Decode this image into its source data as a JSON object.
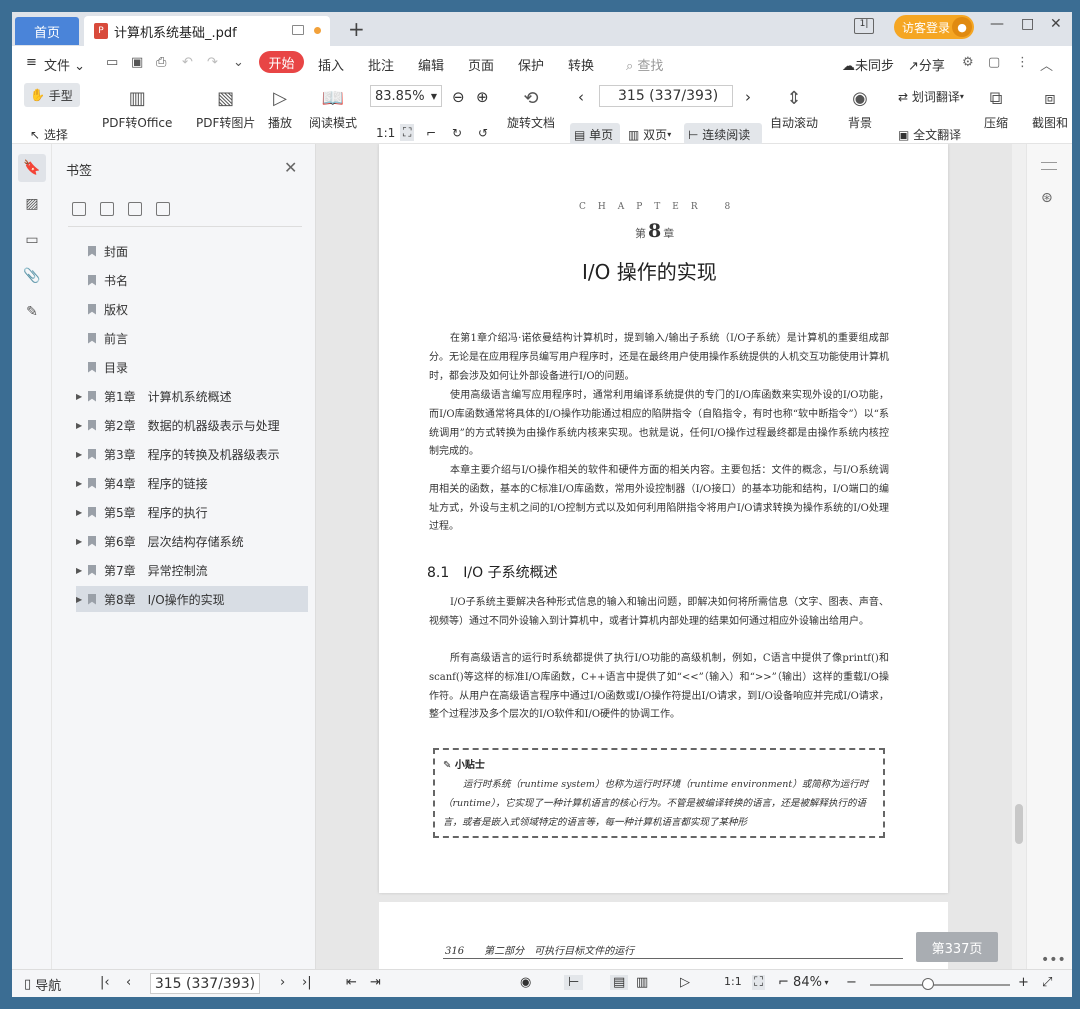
{
  "titlebar": {
    "home_tab": "首页",
    "doc_tab": "计算机系统基础_.pdf",
    "login": "访客登录",
    "pdf_icon": "P"
  },
  "menu": {
    "file": "文件",
    "items": [
      "开始",
      "插入",
      "批注",
      "编辑",
      "页面",
      "保护",
      "转换"
    ],
    "search": "查找",
    "unsync": "未同步",
    "share": "分享"
  },
  "ribbon": {
    "hand": "手型",
    "select": "选择",
    "pdf_office": "PDF转Office",
    "pdf_image": "PDF转图片",
    "play": "播放",
    "read_mode": "阅读模式",
    "zoom": "83.85%",
    "page": "315 (337/393)",
    "rotate": "旋转文档",
    "single": "单页",
    "double": "双页",
    "continuous": "连续阅读",
    "auto_scroll": "自动滚动",
    "background": "背景",
    "word_translate": "划词翻译",
    "full_translate": "全文翻译",
    "compress": "压缩",
    "screenshot": "截图和"
  },
  "sidebar": {
    "title": "书签",
    "items": [
      {
        "label": "封面",
        "expand": false
      },
      {
        "label": "书名",
        "expand": false
      },
      {
        "label": "版权",
        "expand": false
      },
      {
        "label": "前言",
        "expand": false
      },
      {
        "label": "目录",
        "expand": false
      },
      {
        "label": "第1章　计算机系统概述",
        "expand": true
      },
      {
        "label": "第2章　数据的机器级表示与处理",
        "expand": true
      },
      {
        "label": "第3章　程序的转换及机器级表示",
        "expand": true
      },
      {
        "label": "第4章　程序的链接",
        "expand": true
      },
      {
        "label": "第5章　程序的执行",
        "expand": true
      },
      {
        "label": "第6章　层次结构存储系统",
        "expand": true
      },
      {
        "label": "第7章　异常控制流",
        "expand": true
      },
      {
        "label": "第8章　I/O操作的实现",
        "expand": true
      }
    ]
  },
  "doc": {
    "chapter_en": "CHAPTER 8",
    "chapter_pre": "第",
    "chapter_num": "8",
    "chapter_post": "章",
    "title": "I/O 操作的实现",
    "paras": [
      "在第1章介绍冯·诺依曼结构计算机时，提到输入/输出子系统（I/O子系统）是计算机的重要组成部分。无论是在应用程序员编写用户程序时，还是在最终用户使用操作系统提供的人机交互功能使用计算机时，都会涉及如何让外部设备进行I/O的问题。",
      "使用高级语言编写应用程序时，通常利用编译系统提供的专门的I/O库函数来实现外设的I/O功能，而I/O库函数通常将具体的I/O操作功能通过相应的陷阱指令（自陷指令，有时也称“软中断指令”）以“系统调用”的方式转换为由操作系统内核来实现。也就是说，任何I/O操作过程最终都是由操作系统内核控制完成的。",
      "本章主要介绍与I/O操作相关的软件和硬件方面的相关内容。主要包括：文件的概念，与I/O系统调用相关的函数，基本的C标准I/O库函数，常用外设控制器（I/O接口）的基本功能和结构，I/O端口的编址方式，外设与主机之间的I/O控制方式以及如何利用陷阱指令将用户I/O请求转换为操作系统的I/O处理过程。"
    ],
    "section": "8.1　I/O 子系统概述",
    "paras2": [
      "I/O子系统主要解决各种形式信息的输入和输出问题，即解决如何将所需信息（文字、图表、声音、视频等）通过不同外设输入到计算机中，或者计算机内部处理的结果如何通过相应外设输出给用户。",
      "所有高级语言的运行时系统都提供了执行I/O功能的高级机制，例如，C语言中提供了像printf()和scanf()等这样的标准I/O库函数，C++语言中提供了如“<<”（输入）和“>>”（输出）这样的重载I/O操作符。从用户在高级语言程序中通过I/O函数或I/O操作符提出I/O请求，到I/O设备响应并完成I/O请求，整个过程涉及多个层次的I/O软件和I/O硬件的协调工作。"
    ],
    "tip_title": "小贴士",
    "tip_body": "运行时系统（runtime system）也称为运行时环境（runtime environment）或简称为运行时（runtime），它实现了一种计算机语言的核心行为。不管是被编译转换的语言，还是被解释执行的语言，或者是嵌入式领域特定的语言等，每一种计算机语言都实现了某种形",
    "p2_header": "316　　第二部分　可执行目标文件的运行"
  },
  "page_badge": "第337页",
  "status": {
    "nav": "导航",
    "page": "315 (337/393)",
    "zoom": "84%"
  },
  "colors": {
    "accent": "#4a84d9",
    "start": "#e84545",
    "login": "#f5a623"
  }
}
